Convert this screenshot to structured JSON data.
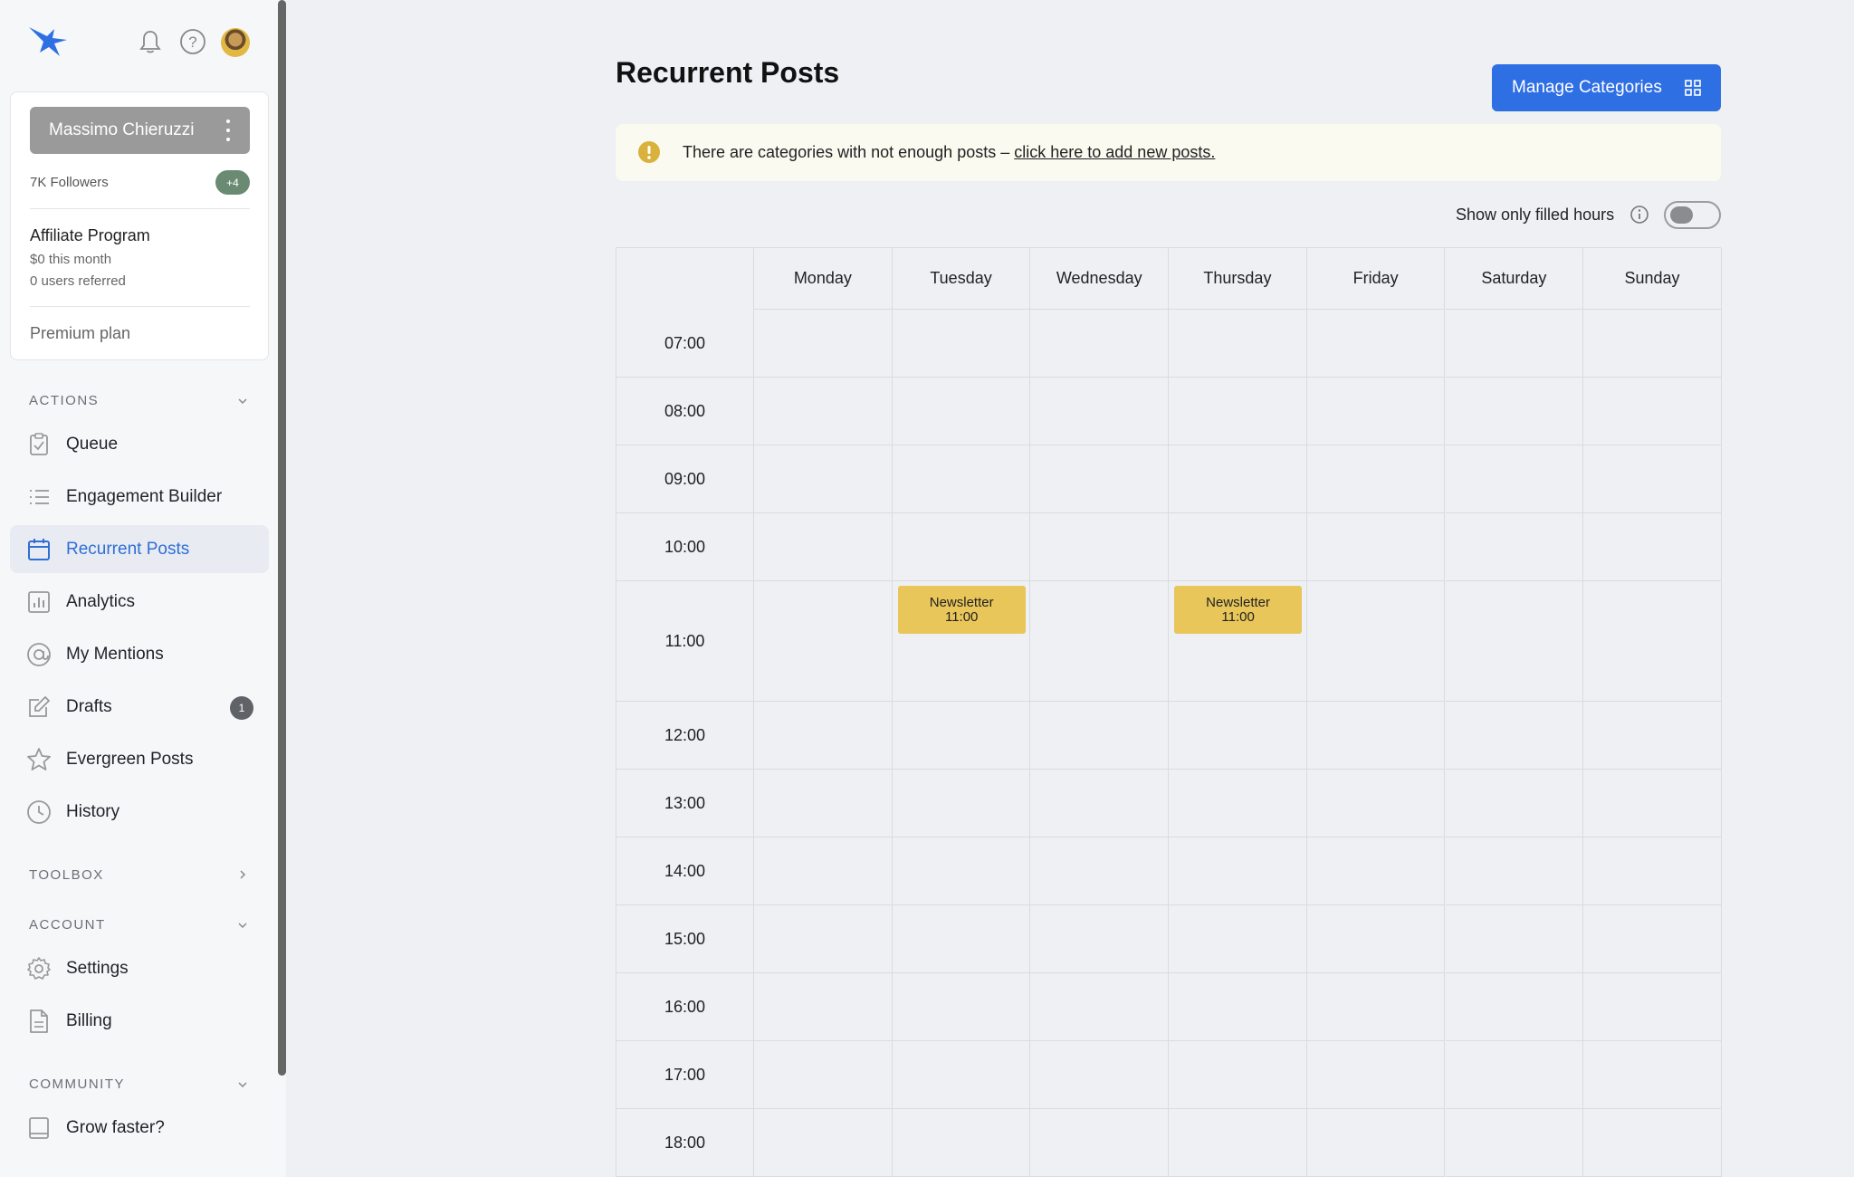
{
  "profile": {
    "name": "Massimo Chieruzzi",
    "followers": "7K Followers",
    "followers_badge": "+4",
    "affiliate_title": "Affiliate Program",
    "affiliate_earnings": "$0 this month",
    "affiliate_referred": "0 users referred",
    "plan": "Premium plan"
  },
  "sidebar": {
    "actions_label": "ACTIONS",
    "toolbox_label": "TOOLBOX",
    "account_label": "ACCOUNT",
    "community_label": "COMMUNITY",
    "items": [
      {
        "label": "Queue",
        "icon": "clipboard-check-icon"
      },
      {
        "label": "Engagement Builder",
        "icon": "list-icon"
      },
      {
        "label": "Recurrent Posts",
        "icon": "calendar-icon",
        "active": true
      },
      {
        "label": "Analytics",
        "icon": "bar-chart-icon"
      },
      {
        "label": "My Mentions",
        "icon": "at-sign-icon"
      },
      {
        "label": "Drafts",
        "icon": "edit-icon",
        "badge": "1"
      },
      {
        "label": "Evergreen Posts",
        "icon": "star-icon"
      },
      {
        "label": "History",
        "icon": "clock-icon"
      },
      {
        "label": "Settings",
        "icon": "gear-icon"
      },
      {
        "label": "Billing",
        "icon": "document-icon"
      },
      {
        "label": "Grow faster?",
        "icon": "book-icon"
      }
    ]
  },
  "main": {
    "title": "Recurrent Posts",
    "manage_label": "Manage Categories",
    "alert_text": "There are categories with not enough posts – ",
    "alert_link": "click here to add new posts.",
    "toggle_label": "Show only filled hours"
  },
  "calendar": {
    "days": [
      "Monday",
      "Tuesday",
      "Wednesday",
      "Thursday",
      "Friday",
      "Saturday",
      "Sunday"
    ],
    "hours": [
      "07:00",
      "08:00",
      "09:00",
      "10:00",
      "11:00",
      "12:00",
      "13:00",
      "14:00",
      "15:00",
      "16:00",
      "17:00",
      "18:00"
    ],
    "events": [
      {
        "day": 1,
        "hour": 4,
        "title": "Newsletter",
        "time": "11:00"
      },
      {
        "day": 3,
        "hour": 4,
        "title": "Newsletter",
        "time": "11:00"
      }
    ]
  },
  "colors": {
    "accent": "#2f6fe4",
    "active_nav": "#2f6fd6",
    "event": "#e8c65a",
    "alert_icon": "#d8b23c"
  }
}
